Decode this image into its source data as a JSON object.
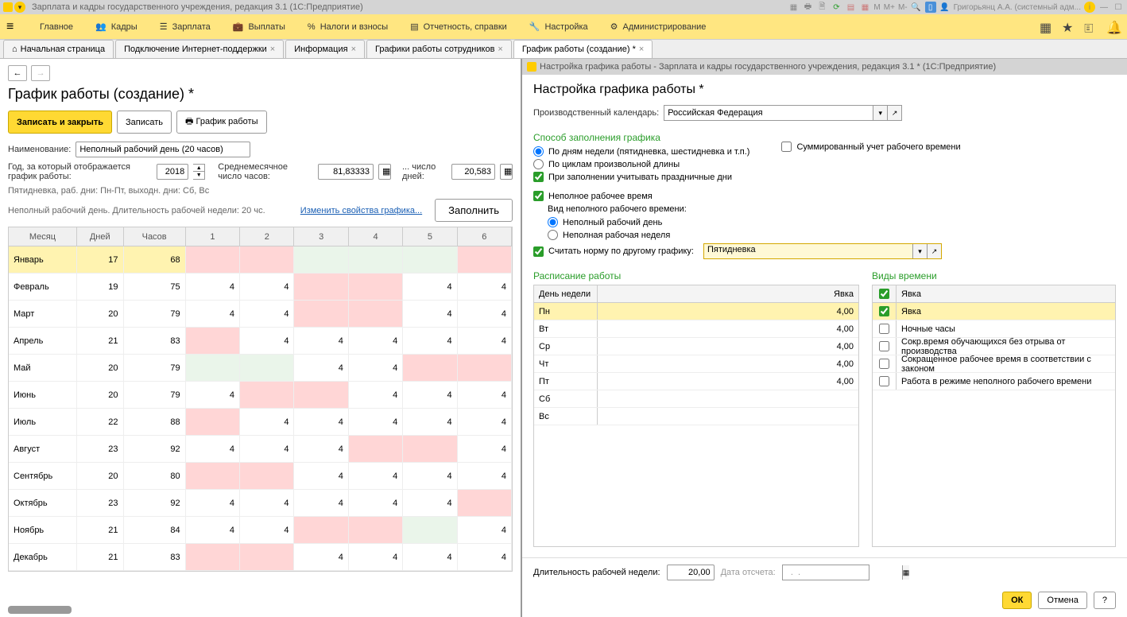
{
  "titlebar": {
    "app_title": "Зарплата и кадры государственного учреждения, редакция 3.1  (1С:Предприятие)",
    "user": "Григорьянц А.А. (системный адм...",
    "m_labels": [
      "M",
      "M+",
      "M-"
    ]
  },
  "mainnav": {
    "items": [
      {
        "label": "Главное"
      },
      {
        "label": "Кадры"
      },
      {
        "label": "Зарплата"
      },
      {
        "label": "Выплаты"
      },
      {
        "label": "Налоги и взносы"
      },
      {
        "label": "Отчетность, справки"
      },
      {
        "label": "Настройка"
      },
      {
        "label": "Администрирование"
      }
    ]
  },
  "tabs": [
    {
      "label": "Начальная страница",
      "home": true,
      "closable": false
    },
    {
      "label": "Подключение Интернет-поддержки",
      "closable": true
    },
    {
      "label": "Информация",
      "closable": true
    },
    {
      "label": "Графики работы сотрудников",
      "closable": true
    },
    {
      "label": "График работы (создание) *",
      "closable": true,
      "active": true
    }
  ],
  "left": {
    "title": "График работы (создание) *",
    "btn_save_close": "Записать и закрыть",
    "btn_save": "Записать",
    "btn_print": "График работы",
    "name_label": "Наименование:",
    "name_value": "Неполный рабочий день (20 часов)",
    "year_label": "Год, за который отображается график работы:",
    "year_value": "2018",
    "avg_hours_label": "Среднемесячное число часов:",
    "avg_hours_value": "81,83333",
    "days_label": "... число дней:",
    "days_value": "20,583",
    "desc1": "Пятидневка, раб. дни: Пн-Пт, выходн. дни: Сб, Вс",
    "desc2": "Неполный рабочий день. Длительность рабочей недели: 20 чс.",
    "change_props": "Изменить свойства графика...",
    "btn_fill": "Заполнить",
    "cols": {
      "month": "Месяц",
      "days": "Дней",
      "hours": "Часов",
      "c1": "1",
      "c2": "2",
      "c3": "3",
      "c4": "4",
      "c5": "5",
      "c6": "6"
    },
    "rows": [
      {
        "m": "Январь",
        "d": "17",
        "h": "68",
        "c": [
          {
            "v": "",
            "s": "p"
          },
          {
            "v": "",
            "s": "p"
          },
          {
            "v": "",
            "s": "g"
          },
          {
            "v": "",
            "s": "g"
          },
          {
            "v": "",
            "s": "g"
          },
          {
            "v": "",
            "s": "p"
          }
        ],
        "sel": true
      },
      {
        "m": "Февраль",
        "d": "19",
        "h": "75",
        "c": [
          {
            "v": "4",
            "s": ""
          },
          {
            "v": "4",
            "s": ""
          },
          {
            "v": "",
            "s": "p"
          },
          {
            "v": "",
            "s": "p"
          },
          {
            "v": "4",
            "s": ""
          },
          {
            "v": "4",
            "s": ""
          }
        ]
      },
      {
        "m": "Март",
        "d": "20",
        "h": "79",
        "c": [
          {
            "v": "4",
            "s": ""
          },
          {
            "v": "4",
            "s": ""
          },
          {
            "v": "",
            "s": "p"
          },
          {
            "v": "",
            "s": "p"
          },
          {
            "v": "4",
            "s": ""
          },
          {
            "v": "4",
            "s": ""
          }
        ]
      },
      {
        "m": "Апрель",
        "d": "21",
        "h": "83",
        "c": [
          {
            "v": "",
            "s": "p"
          },
          {
            "v": "4",
            "s": ""
          },
          {
            "v": "4",
            "s": ""
          },
          {
            "v": "4",
            "s": ""
          },
          {
            "v": "4",
            "s": ""
          },
          {
            "v": "4",
            "s": ""
          }
        ]
      },
      {
        "m": "Май",
        "d": "20",
        "h": "79",
        "c": [
          {
            "v": "",
            "s": "g"
          },
          {
            "v": "",
            "s": "g"
          },
          {
            "v": "4",
            "s": ""
          },
          {
            "v": "4",
            "s": ""
          },
          {
            "v": "",
            "s": "p"
          },
          {
            "v": "",
            "s": "p"
          }
        ]
      },
      {
        "m": "Июнь",
        "d": "20",
        "h": "79",
        "c": [
          {
            "v": "4",
            "s": ""
          },
          {
            "v": "",
            "s": "p"
          },
          {
            "v": "",
            "s": "p"
          },
          {
            "v": "4",
            "s": ""
          },
          {
            "v": "4",
            "s": ""
          },
          {
            "v": "4",
            "s": ""
          }
        ]
      },
      {
        "m": "Июль",
        "d": "22",
        "h": "88",
        "c": [
          {
            "v": "",
            "s": "p"
          },
          {
            "v": "4",
            "s": ""
          },
          {
            "v": "4",
            "s": ""
          },
          {
            "v": "4",
            "s": ""
          },
          {
            "v": "4",
            "s": ""
          },
          {
            "v": "4",
            "s": ""
          }
        ]
      },
      {
        "m": "Август",
        "d": "23",
        "h": "92",
        "c": [
          {
            "v": "4",
            "s": ""
          },
          {
            "v": "4",
            "s": ""
          },
          {
            "v": "4",
            "s": ""
          },
          {
            "v": "",
            "s": "p"
          },
          {
            "v": "",
            "s": "p"
          },
          {
            "v": "4",
            "s": ""
          }
        ]
      },
      {
        "m": "Сентябрь",
        "d": "20",
        "h": "80",
        "c": [
          {
            "v": "",
            "s": "p"
          },
          {
            "v": "",
            "s": "p"
          },
          {
            "v": "4",
            "s": ""
          },
          {
            "v": "4",
            "s": ""
          },
          {
            "v": "4",
            "s": ""
          },
          {
            "v": "4",
            "s": ""
          }
        ]
      },
      {
        "m": "Октябрь",
        "d": "23",
        "h": "92",
        "c": [
          {
            "v": "4",
            "s": ""
          },
          {
            "v": "4",
            "s": ""
          },
          {
            "v": "4",
            "s": ""
          },
          {
            "v": "4",
            "s": ""
          },
          {
            "v": "4",
            "s": ""
          },
          {
            "v": "",
            "s": "p"
          }
        ]
      },
      {
        "m": "Ноябрь",
        "d": "21",
        "h": "84",
        "c": [
          {
            "v": "4",
            "s": ""
          },
          {
            "v": "4",
            "s": ""
          },
          {
            "v": "",
            "s": "p"
          },
          {
            "v": "",
            "s": "p"
          },
          {
            "v": "",
            "s": "g"
          },
          {
            "v": "4",
            "s": ""
          }
        ]
      },
      {
        "m": "Декабрь",
        "d": "21",
        "h": "83",
        "c": [
          {
            "v": "",
            "s": "p"
          },
          {
            "v": "",
            "s": "p"
          },
          {
            "v": "4",
            "s": ""
          },
          {
            "v": "4",
            "s": ""
          },
          {
            "v": "4",
            "s": ""
          },
          {
            "v": "4",
            "s": ""
          }
        ]
      }
    ]
  },
  "right": {
    "dlg_title": "Настройка графика работы - Зарплата и кадры государственного учреждения, редакция 3.1 *  (1С:Предприятие)",
    "heading": "Настройка графика работы *",
    "calendar_label": "Производственный календарь:",
    "calendar_value": "Российская Федерация",
    "fill_method_title": "Способ заполнения графика",
    "sum_time_label": "Суммированный учет рабочего времени",
    "radio_weekdays": "По дням недели (пятидневка, шестидневка и т.п.)",
    "radio_cycles": "По циклам произвольной длины",
    "chk_holidays": "При заполнении учитывать праздничные дни",
    "chk_parttime": "Неполное рабочее время",
    "parttime_kind_label": "Вид неполного рабочего времени:",
    "radio_partday": "Неполный рабочий день",
    "radio_partweek": "Неполная рабочая неделя",
    "chk_other_schedule": "Считать норму по другому графику:",
    "other_schedule_value": "Пятидневка",
    "schedule_title": "Расписание работы",
    "timetypes_title": "Виды времени",
    "sched_cols": {
      "day": "День недели",
      "val": "Явка"
    },
    "sched_rows": [
      {
        "d": "Пн",
        "v": "4,00",
        "sel": true
      },
      {
        "d": "Вт",
        "v": "4,00"
      },
      {
        "d": "Ср",
        "v": "4,00"
      },
      {
        "d": "Чт",
        "v": "4,00"
      },
      {
        "d": "Пт",
        "v": "4,00"
      },
      {
        "d": "Сб",
        "v": ""
      },
      {
        "d": "Вс",
        "v": ""
      }
    ],
    "timetypes": [
      {
        "chk": true,
        "name": "Явка",
        "sel": true
      },
      {
        "chk": false,
        "name": "Ночные часы"
      },
      {
        "chk": false,
        "name": "Сокр.время обучающихся без отрыва от производства"
      },
      {
        "chk": false,
        "name": "Сокращенное рабочее время в соответствии с законом"
      },
      {
        "chk": false,
        "name": "Работа в режиме неполного рабочего времени"
      }
    ],
    "week_len_label": "Длительность рабочей недели:",
    "week_len_value": "20,00",
    "date_from_label": "Дата отсчета:",
    "date_from_value": "  .  .    ",
    "ok": "ОК",
    "cancel": "Отмена",
    "help": "?"
  }
}
